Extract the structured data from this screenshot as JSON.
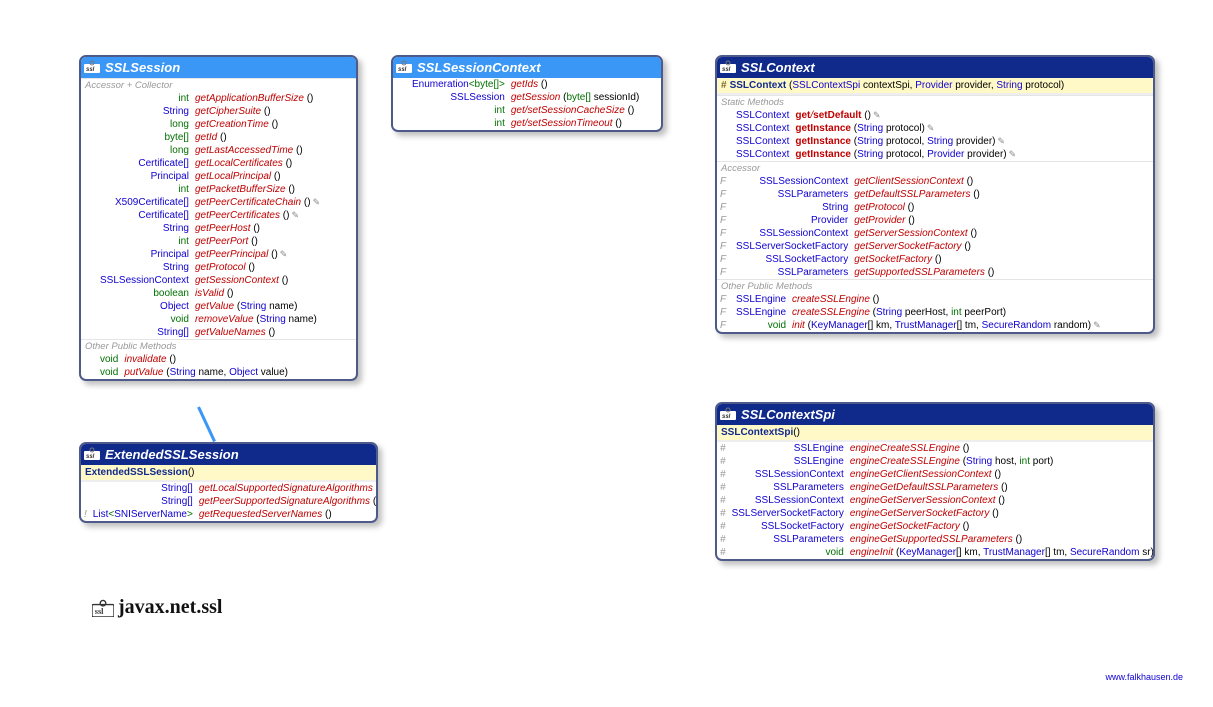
{
  "package": "javax.net.ssl",
  "footer": "www.falkhausen.de",
  "sslSession": {
    "title": "SSLSession",
    "sections": {
      "accessor": "Accessor + Collector",
      "other": "Other Public Methods"
    },
    "rows": {
      "r0": {
        "ret": "int",
        "retKind": "prim",
        "name": "getApplicationBufferSize",
        "params": "()",
        "mod": ""
      },
      "r1": {
        "ret": "String",
        "retKind": "type",
        "name": "getCipherSuite",
        "params": "()",
        "mod": ""
      },
      "r2": {
        "ret": "long",
        "retKind": "prim",
        "name": "getCreationTime",
        "params": "()",
        "mod": ""
      },
      "r3": {
        "ret": "byte[]",
        "retKind": "prim",
        "name": "getId",
        "params": "()",
        "mod": ""
      },
      "r4": {
        "ret": "long",
        "retKind": "prim",
        "name": "getLastAccessedTime",
        "params": "()",
        "mod": ""
      },
      "r5": {
        "ret": "Certificate[]",
        "retKind": "type",
        "name": "getLocalCertificates",
        "params": "()",
        "mod": ""
      },
      "r6": {
        "ret": "Principal",
        "retKind": "type",
        "name": "getLocalPrincipal",
        "params": "()",
        "mod": ""
      },
      "r7": {
        "ret": "int",
        "retKind": "prim",
        "name": "getPacketBufferSize",
        "params": "()",
        "mod": ""
      },
      "r8": {
        "ret": "X509Certificate[]",
        "retKind": "type",
        "name": "getPeerCertificateChain",
        "params": "()",
        "mod": "",
        "throws": true
      },
      "r9": {
        "ret": "Certificate[]",
        "retKind": "type",
        "name": "getPeerCertificates",
        "params": "()",
        "mod": "",
        "throws": true
      },
      "r10": {
        "ret": "String",
        "retKind": "type",
        "name": "getPeerHost",
        "params": "()",
        "mod": ""
      },
      "r11": {
        "ret": "int",
        "retKind": "prim",
        "name": "getPeerPort",
        "params": "()",
        "mod": ""
      },
      "r12": {
        "ret": "Principal",
        "retKind": "type",
        "name": "getPeerPrincipal",
        "params": "()",
        "mod": "",
        "throws": true
      },
      "r13": {
        "ret": "String",
        "retKind": "type",
        "name": "getProtocol",
        "params": "()",
        "mod": ""
      },
      "r14": {
        "ret": "SSLSessionContext",
        "retKind": "type",
        "name": "getSessionContext",
        "params": "()",
        "mod": ""
      },
      "r15": {
        "ret": "boolean",
        "retKind": "prim",
        "name": "isValid",
        "params": "()",
        "mod": ""
      },
      "r16": {
        "ret": "Object",
        "retKind": "type",
        "name": "getValue",
        "paramsHtml": "(<span class='type'>String</span> name)",
        "mod": ""
      },
      "r17": {
        "ret": "void",
        "retKind": "prim",
        "name": "removeValue",
        "paramsHtml": "(<span class='type'>String</span> name)",
        "mod": ""
      },
      "r18": {
        "ret": "String[]",
        "retKind": "type",
        "name": "getValueNames",
        "params": "()",
        "mod": ""
      },
      "r19": {
        "ret": "void",
        "retKind": "prim",
        "name": "invalidate",
        "params": "()",
        "mod": ""
      },
      "r20": {
        "ret": "void",
        "retKind": "prim",
        "name": "putValue",
        "paramsHtml": "(<span class='type'>String</span> name, <span class='type'>Object</span> value)",
        "mod": ""
      }
    }
  },
  "extSslSession": {
    "title": "ExtendedSSLSession",
    "ctor": {
      "vis": "",
      "name": "ExtendedSSLSession",
      "params": "()"
    },
    "rows": {
      "r0": {
        "mod": "",
        "ret": "String[]",
        "retKind": "type",
        "name": "getLocalSupportedSignatureAlgorithms",
        "params": "()"
      },
      "r1": {
        "mod": "",
        "ret": "String[]",
        "retKind": "type",
        "name": "getPeerSupportedSignatureAlgorithms",
        "params": "()"
      },
      "r2": {
        "mod": "!",
        "retHtml": "<span class='type'>List</span>&lt;<span class='type'>SNIServerName</span>&gt;",
        "name": "getRequestedServerNames",
        "params": "()"
      }
    }
  },
  "sslSessionContext": {
    "title": "SSLSessionContext",
    "rows": {
      "r0": {
        "retHtml": "<span class='type'>Enumeration</span>&lt;<span class='prim'>byte[]</span>&gt;",
        "name": "getIds",
        "params": "()"
      },
      "r1": {
        "ret": "SSLSession",
        "retKind": "type",
        "name": "getSession",
        "paramsHtml": "(<span class='prim'>byte[]</span> sessionId)"
      },
      "r2": {
        "ret": "int",
        "retKind": "prim",
        "nameHtml": "get/<span class='method-name'>setSessionCacheSize</span>",
        "params": "()"
      },
      "r3": {
        "ret": "int",
        "retKind": "prim",
        "nameHtml": "get/<span class='method-name'>setSessionTimeout</span>",
        "params": "()"
      }
    }
  },
  "sslContext": {
    "title": "SSLContext",
    "ctor": {
      "vis": "#",
      "name": "SSLContext",
      "paramsHtml": "(<span class='type'>SSLContextSpi</span> contextSpi, <span class='type'>Provider</span> provider, <span class='type'>String</span> protocol)"
    },
    "sections": {
      "static": "Static Methods",
      "accessor": "Accessor",
      "other": "Other Public Methods"
    },
    "rows": {
      "s0": {
        "ret": "SSLContext",
        "retKind": "type",
        "nameHtml": "<span class='method-name bold'>get</span>/<span class='method-name bold'>setDefault</span>",
        "params": "()",
        "throws": true
      },
      "s1": {
        "ret": "SSLContext",
        "retKind": "type",
        "name": "getInstance",
        "nameBold": true,
        "paramsHtml": "(<span class='type'>String</span> protocol)",
        "throws": true
      },
      "s2": {
        "ret": "SSLContext",
        "retKind": "type",
        "name": "getInstance",
        "nameBold": true,
        "paramsHtml": "(<span class='type'>String</span> protocol, <span class='type'>String</span> provider)",
        "throws": true
      },
      "s3": {
        "ret": "SSLContext",
        "retKind": "type",
        "name": "getInstance",
        "nameBold": true,
        "paramsHtml": "(<span class='type'>String</span> protocol, <span class='type'>Provider</span> provider)",
        "throws": true
      },
      "a0": {
        "mod": "F",
        "ret": "SSLSessionContext",
        "retKind": "type",
        "name": "getClientSessionContext",
        "params": "()"
      },
      "a1": {
        "mod": "F",
        "ret": "SSLParameters",
        "retKind": "type",
        "name": "getDefaultSSLParameters",
        "params": "()"
      },
      "a2": {
        "mod": "F",
        "ret": "String",
        "retKind": "type",
        "name": "getProtocol",
        "params": "()"
      },
      "a3": {
        "mod": "F",
        "ret": "Provider",
        "retKind": "type",
        "name": "getProvider",
        "params": "()"
      },
      "a4": {
        "mod": "F",
        "ret": "SSLSessionContext",
        "retKind": "type",
        "name": "getServerSessionContext",
        "params": "()"
      },
      "a5": {
        "mod": "F",
        "ret": "SSLServerSocketFactory",
        "retKind": "type",
        "name": "getServerSocketFactory",
        "params": "()"
      },
      "a6": {
        "mod": "F",
        "ret": "SSLSocketFactory",
        "retKind": "type",
        "name": "getSocketFactory",
        "params": "()"
      },
      "a7": {
        "mod": "F",
        "ret": "SSLParameters",
        "retKind": "type",
        "name": "getSupportedSSLParameters",
        "params": "()"
      },
      "o0": {
        "mod": "F",
        "ret": "SSLEngine",
        "retKind": "type",
        "name": "createSSLEngine",
        "params": "()"
      },
      "o1": {
        "mod": "F",
        "ret": "SSLEngine",
        "retKind": "type",
        "name": "createSSLEngine",
        "paramsHtml": "(<span class='type'>String</span> peerHost, <span class='prim'>int</span> peerPort)"
      },
      "o2": {
        "mod": "F",
        "ret": "void",
        "retKind": "prim",
        "name": "init",
        "paramsHtml": "(<span class='type'>KeyManager</span>[] km, <span class='type'>TrustManager</span>[] tm, <span class='type'>SecureRandom</span> random)",
        "throws": true
      }
    }
  },
  "sslContextSpi": {
    "title": "SSLContextSpi",
    "ctor": {
      "vis": "",
      "name": "SSLContextSpi",
      "params": "()"
    },
    "rows": {
      "r0": {
        "mod": "#",
        "ret": "SSLEngine",
        "retKind": "type",
        "name": "engineCreateSSLEngine",
        "params": "()"
      },
      "r1": {
        "mod": "#",
        "ret": "SSLEngine",
        "retKind": "type",
        "name": "engineCreateSSLEngine",
        "paramsHtml": "(<span class='type'>String</span> host, <span class='prim'>int</span> port)"
      },
      "r2": {
        "mod": "#",
        "ret": "SSLSessionContext",
        "retKind": "type",
        "name": "engineGetClientSessionContext",
        "params": "()"
      },
      "r3": {
        "mod": "#",
        "ret": "SSLParameters",
        "retKind": "type",
        "name": "engineGetDefaultSSLParameters",
        "params": "()"
      },
      "r4": {
        "mod": "#",
        "ret": "SSLSessionContext",
        "retKind": "type",
        "name": "engineGetServerSessionContext",
        "params": "()"
      },
      "r5": {
        "mod": "#",
        "ret": "SSLServerSocketFactory",
        "retKind": "type",
        "name": "engineGetServerSocketFactory",
        "params": "()"
      },
      "r6": {
        "mod": "#",
        "ret": "SSLSocketFactory",
        "retKind": "type",
        "name": "engineGetSocketFactory",
        "params": "()"
      },
      "r7": {
        "mod": "#",
        "ret": "SSLParameters",
        "retKind": "type",
        "name": "engineGetSupportedSSLParameters",
        "params": "()"
      },
      "r8": {
        "mod": "#",
        "ret": "void",
        "retKind": "prim",
        "name": "engineInit",
        "paramsHtml": "(<span class='type'>KeyManager</span>[] km, <span class='type'>TrustManager</span>[] tm, <span class='type'>SecureRandom</span> sr)",
        "throws": true
      }
    }
  }
}
